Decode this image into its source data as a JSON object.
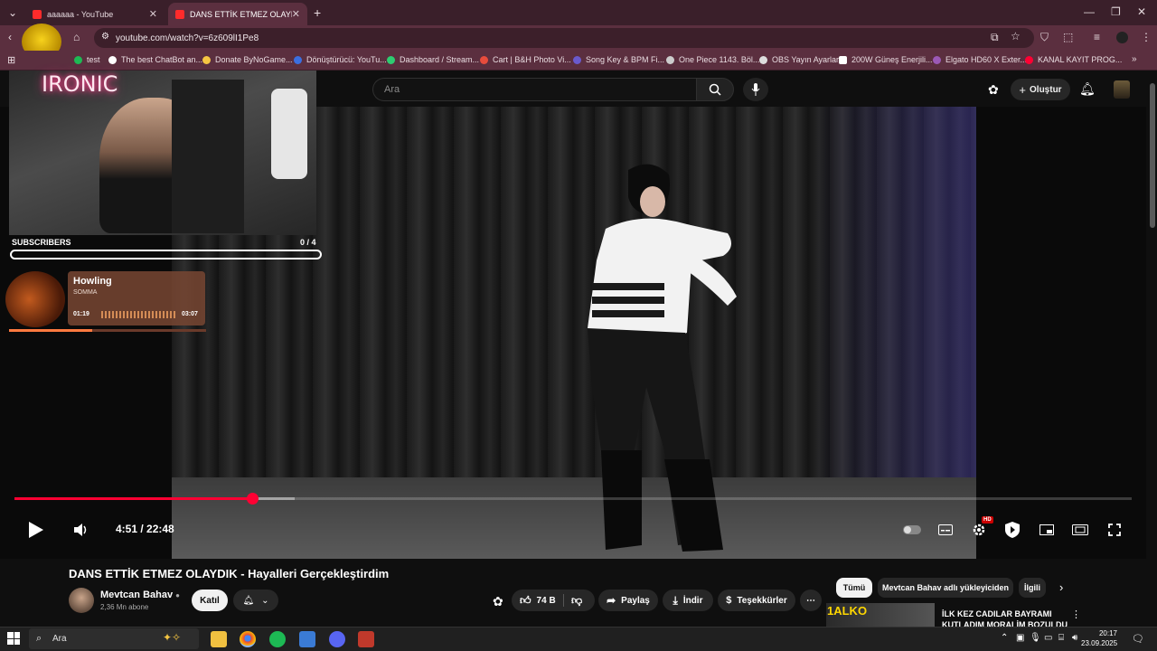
{
  "browser": {
    "tabs": [
      {
        "label": "aaaaaa - YouTube"
      },
      {
        "label": "DANS ETTİK ETMEZ OLAYDIK -"
      }
    ],
    "url": "youtube.com/watch?v=6z609lI1Pe8",
    "bookmarks": [
      {
        "label": "test",
        "color": "#1db954"
      },
      {
        "label": "The best ChatBot an...",
        "color": "#ffffff"
      },
      {
        "label": "Donate ByNoGame...",
        "color": "#f5c542"
      },
      {
        "label": "Dönüştürücü: YouTu...",
        "color": "#3b6fe0"
      },
      {
        "label": "Dashboard / Stream...",
        "color": "#2ecc71"
      },
      {
        "label": "Cart | B&H Photo Vi...",
        "color": "#e74c3c"
      },
      {
        "label": "Song Key & BPM Fi...",
        "color": "#6a5acd"
      },
      {
        "label": "One Piece 1143. Böl...",
        "color": "#cccccc"
      },
      {
        "label": "OBS Yayın Ayarları",
        "color": "#dddddd"
      },
      {
        "label": "200W Güneş Enerjili...",
        "color": "#ffffff"
      },
      {
        "label": "Elgato HD60 X Exter...",
        "color": "#9b59b6"
      },
      {
        "label": "KANAL KAYIT PROG...",
        "color": "#ff0033"
      }
    ]
  },
  "youtube": {
    "search_placeholder": "Ara",
    "create_label": "Oluştur"
  },
  "overlay": {
    "brand": "IRONIC",
    "subscribers_label": "SUBSCRIBERS",
    "subscribers_count": "0 / 4",
    "song_title": "Howling",
    "song_artist": "SOMMA",
    "song_time_current": "01:19",
    "song_time_total": "03:07",
    "song_progress": 0.42
  },
  "player": {
    "time_display": "4:51 / 22:48",
    "progress_fraction": 0.213,
    "hd_badge": "HD"
  },
  "video": {
    "title": "DANS ETTİK ETMEZ OLAYDIK - Hayalleri Gerçekleştirdim",
    "channel_name": "Mevtcan Bahav",
    "channel_subs": "2,36 Mn abone",
    "join_label": "Katıl",
    "like_count": "74 B",
    "share_label": "Paylaş",
    "download_label": "İndir",
    "thanks_label": "Teşekkürler"
  },
  "chips": [
    {
      "label": "Tümü"
    },
    {
      "label": "Mevtcan Bahav adlı yükleyiciden"
    },
    {
      "label": "İlgili"
    }
  ],
  "recommendation": {
    "title": "İLK KEZ CADILAR BAYRAMI KUTLADIM MORALİM BOZULDU",
    "thumb_text": "1ALKO"
  },
  "taskbar": {
    "search_label": "Ara",
    "time": "20:17",
    "date": "23.09.2025"
  },
  "colors": {
    "accent": "#ff0033",
    "chrome": "#5b2f3f"
  }
}
